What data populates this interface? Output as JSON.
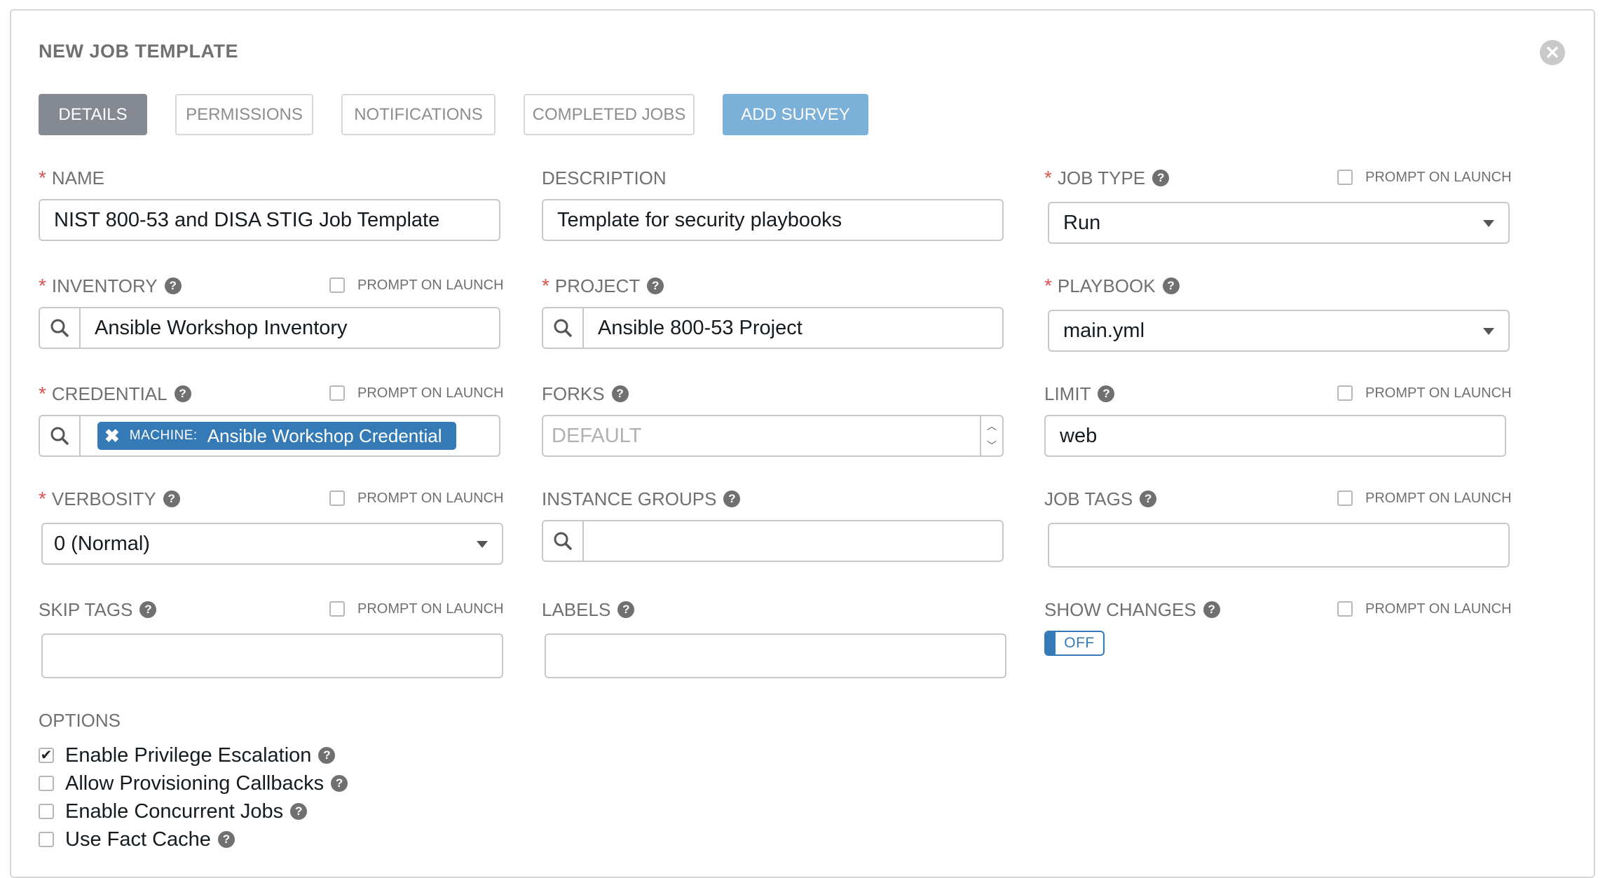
{
  "header": {
    "title": "NEW JOB TEMPLATE",
    "close_glyph": "✕"
  },
  "tabs": [
    {
      "label": "DETAILS",
      "active": true
    },
    {
      "label": "PERMISSIONS"
    },
    {
      "label": "NOTIFICATIONS"
    },
    {
      "label": "COMPLETED JOBS"
    },
    {
      "label": "ADD SURVEY"
    }
  ],
  "prompt_on_launch_label": "PROMPT ON LAUNCH",
  "help_glyph": "?",
  "required_mark": "*",
  "fields": {
    "name": {
      "label": "NAME",
      "value": "NIST 800-53 and DISA STIG Job Template"
    },
    "description": {
      "label": "DESCRIPTION",
      "value": "Template for security playbooks"
    },
    "job_type": {
      "label": "JOB TYPE",
      "value": "Run"
    },
    "inventory": {
      "label": "INVENTORY",
      "value": "Ansible Workshop Inventory"
    },
    "project": {
      "label": "PROJECT",
      "value": "Ansible 800-53 Project"
    },
    "playbook": {
      "label": "PLAYBOOK",
      "value": "main.yml"
    },
    "credential": {
      "label": "CREDENTIAL",
      "chip_kind": "MACHINE:",
      "chip_value": "Ansible Workshop Credential"
    },
    "forks": {
      "label": "FORKS",
      "placeholder": "DEFAULT"
    },
    "limit": {
      "label": "LIMIT",
      "value": "web"
    },
    "verbosity": {
      "label": "VERBOSITY",
      "value": "0 (Normal)"
    },
    "instance_groups": {
      "label": "INSTANCE GROUPS",
      "value": ""
    },
    "job_tags": {
      "label": "JOB TAGS",
      "value": ""
    },
    "skip_tags": {
      "label": "SKIP TAGS",
      "value": ""
    },
    "labels": {
      "label": "LABELS",
      "value": ""
    },
    "show_changes": {
      "label": "SHOW CHANGES",
      "toggle_state": "OFF"
    }
  },
  "options": {
    "title": "OPTIONS",
    "items": [
      {
        "label": "Enable Privilege Escalation",
        "checked": true
      },
      {
        "label": "Allow Provisioning Callbacks",
        "checked": false
      },
      {
        "label": "Enable Concurrent Jobs",
        "checked": false
      },
      {
        "label": "Use Fact Cache",
        "checked": false
      }
    ]
  },
  "colors": {
    "accent": "#337ab7",
    "survey_button": "#7bb0d9",
    "active_tab": "#848992",
    "required": "#d9534f",
    "label_gray": "#707070"
  },
  "icons": {
    "search": "search-icon",
    "help": "help-icon",
    "close": "close-icon",
    "caret": "chevron-down-icon",
    "remove_chip": "remove-icon"
  }
}
